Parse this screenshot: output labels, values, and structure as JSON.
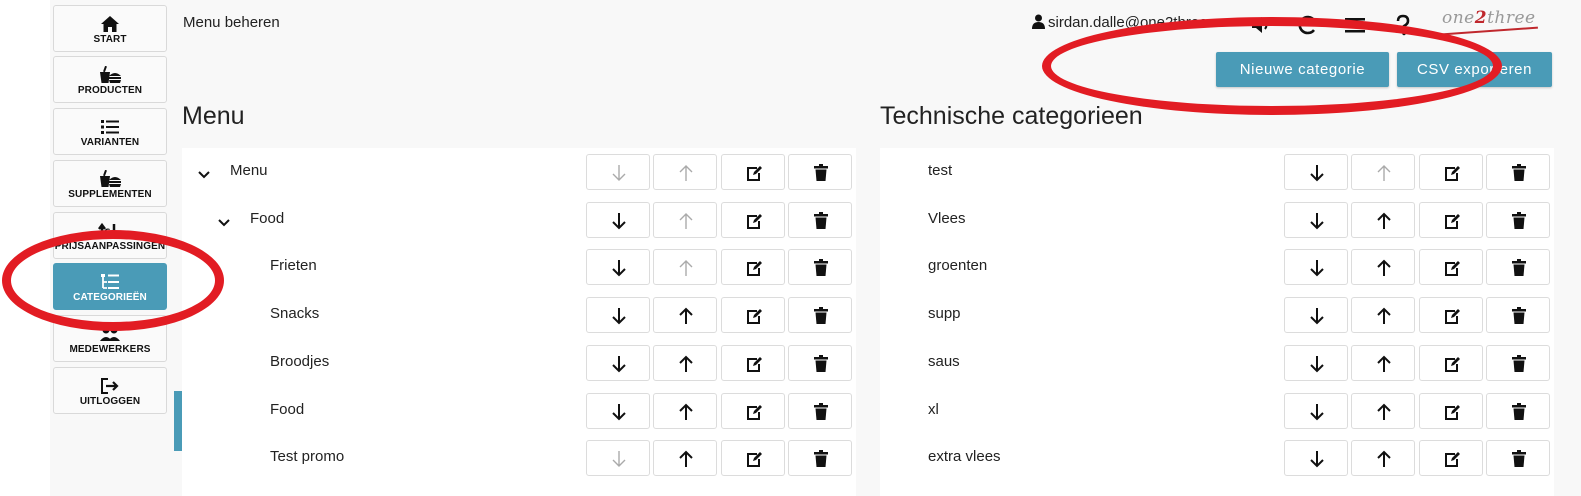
{
  "sidebar": {
    "items": [
      {
        "label": "START",
        "icon": "home-icon"
      },
      {
        "label": "PRODUCTEN",
        "icon": "food-icon"
      },
      {
        "label": "VARIANTEN",
        "icon": "list-icon"
      },
      {
        "label": "SUPPLEMENTEN",
        "icon": "food-icon"
      },
      {
        "label": "PRIJSAANPASSINGEN",
        "icon": "price-arrows-icon"
      },
      {
        "label": "CATEGORIEËN",
        "icon": "tree-list-icon"
      },
      {
        "label": "MEDEWERKERS",
        "icon": "users-icon"
      },
      {
        "label": "UITLOGGEN",
        "icon": "logout-icon"
      }
    ],
    "active": "CATEGORIEËN"
  },
  "header": {
    "page_title": "Menu beheren",
    "user": "sirdan.dalle@one2three",
    "logo": {
      "one": "one",
      "two": "2",
      "three": "three"
    }
  },
  "toolbar": {
    "new_category_label": "Nieuwe categorie",
    "csv_export_label": "CSV exporteren"
  },
  "menu": {
    "title": "Menu",
    "rows": [
      {
        "name": "Menu",
        "level": 0,
        "expandable": true,
        "can_down": false,
        "can_up": false
      },
      {
        "name": "Food",
        "level": 1,
        "expandable": true,
        "can_down": true,
        "can_up": false
      },
      {
        "name": "Frieten",
        "level": 2,
        "expandable": false,
        "can_down": true,
        "can_up": false
      },
      {
        "name": "Snacks",
        "level": 2,
        "expandable": false,
        "can_down": true,
        "can_up": true
      },
      {
        "name": "Broodjes",
        "level": 2,
        "expandable": false,
        "can_down": true,
        "can_up": true
      },
      {
        "name": "Food",
        "level": 2,
        "expandable": false,
        "can_down": true,
        "can_up": true
      },
      {
        "name": "Test promo",
        "level": 2,
        "expandable": false,
        "can_down": false,
        "can_up": true
      }
    ]
  },
  "technical": {
    "title": "Technische categorieen",
    "rows": [
      {
        "name": "test",
        "can_down": true,
        "can_up": false
      },
      {
        "name": "Vlees",
        "can_down": true,
        "can_up": true
      },
      {
        "name": "groenten",
        "can_down": true,
        "can_up": true
      },
      {
        "name": "supp",
        "can_down": true,
        "can_up": true
      },
      {
        "name": "saus",
        "can_down": true,
        "can_up": true
      },
      {
        "name": "xl",
        "can_down": true,
        "can_up": true
      },
      {
        "name": "extra vlees",
        "can_down": true,
        "can_up": true
      }
    ]
  },
  "colors": {
    "accent": "#4a9bb7",
    "annotation": "#e21c23",
    "disabled_arrow": "#aaaaaa"
  }
}
